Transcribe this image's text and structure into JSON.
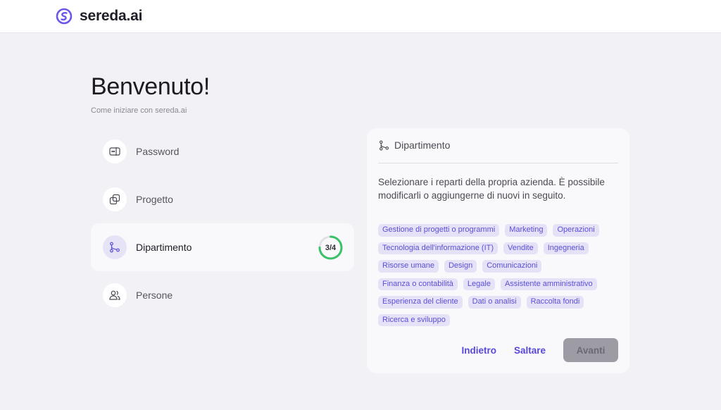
{
  "brand": {
    "name": "sereda.ai",
    "accent": "#6a57e6"
  },
  "welcome": {
    "title": "Benvenuto!",
    "subtitle": "Come iniziare con sereda.ai"
  },
  "steps": [
    {
      "label": "Password",
      "icon": "password-icon",
      "active": false
    },
    {
      "label": "Progetto",
      "icon": "project-icon",
      "active": false
    },
    {
      "label": "Dipartimento",
      "icon": "department-icon",
      "active": true,
      "progress": "3/4",
      "progress_value": 0.75
    },
    {
      "label": "Persone",
      "icon": "people-icon",
      "active": false
    }
  ],
  "card": {
    "title": "Dipartimento",
    "description": "Selezionare i reparti della propria azienda. È possibile modificarli o aggiungerne di nuovi in seguito.",
    "tags": [
      "Gestione di progetti o programmi",
      "Marketing",
      "Operazioni",
      "Tecnologia dell'informazione (IT)",
      "Vendite",
      "Ingegneria",
      "Risorse umane",
      "Design",
      "Comunicazioni",
      "Finanza o contabilità",
      "Legale",
      "Assistente amministrativo",
      "Esperienza del cliente",
      "Dati o analisi",
      "Raccolta fondi",
      "Ricerca e sviluppo"
    ],
    "back_label": "Indietro",
    "skip_label": "Saltare",
    "next_label": "Avanti"
  },
  "colors": {
    "progress": "#3bc167",
    "tag_bg": "#e5e2f8",
    "tag_text": "#5b4fd6"
  }
}
